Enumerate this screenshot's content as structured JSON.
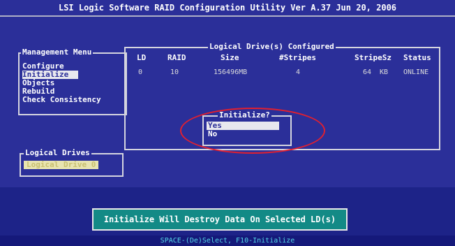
{
  "title": "LSI Logic Software RAID Configuration Utility Ver A.37 Jun 20, 2006",
  "management_menu": {
    "title": "Management Menu",
    "items": [
      {
        "label": "Configure",
        "selected": false
      },
      {
        "label": "Initialize",
        "selected": true
      },
      {
        "label": "Objects",
        "selected": false
      },
      {
        "label": "Rebuild",
        "selected": false
      },
      {
        "label": "Check Consistency",
        "selected": false
      }
    ]
  },
  "logical_drives_configured": {
    "title": "Logical Drive(s) Configured",
    "columns": [
      "LD",
      "RAID",
      "Size",
      "#Stripes",
      "StripeSz",
      "Status"
    ],
    "rows": [
      {
        "ld": "0",
        "raid": "10",
        "size": "156496MB",
        "stripes": "4",
        "stripe_size": "64",
        "stripe_unit": "KB",
        "status": "ONLINE"
      }
    ]
  },
  "logical_drives": {
    "title": "Logical Drives",
    "items": [
      {
        "label": "Logical Drive 0",
        "selected": true
      }
    ]
  },
  "initialize_dialog": {
    "title": "Initialize?",
    "options": [
      {
        "label": "Yes",
        "selected": true
      },
      {
        "label": "No",
        "selected": false
      }
    ]
  },
  "warning": "Initialize Will Destroy Data On Selected LD(s)",
  "key_hint": "SPACE-(De)Select,  F10-Initialize",
  "colors": {
    "background": "#2b2f99",
    "highlight": "#e8e8ee",
    "warning_bg": "#138a86",
    "annotation_ellipse": "#e02030",
    "hint_text": "#55d8e8"
  }
}
